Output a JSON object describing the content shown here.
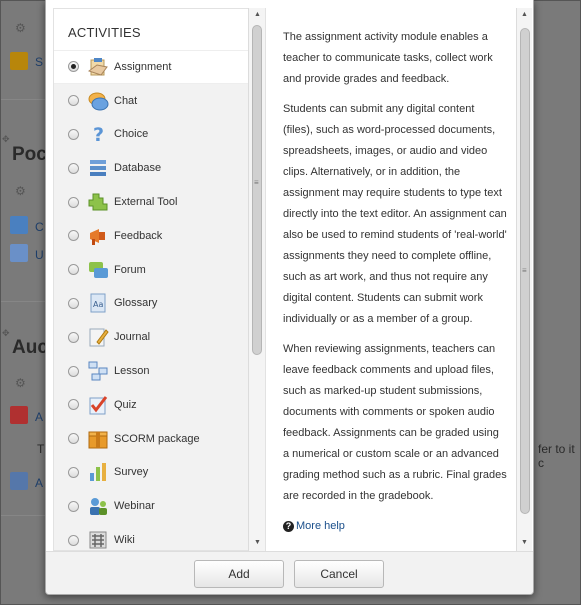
{
  "background": {
    "heading_1": "Poc",
    "heading_2": "Auc",
    "link_1": "S",
    "link_2": "C",
    "link_3": "U",
    "link_4": "A",
    "link_5": "A",
    "text_1": "Tl",
    "text_2": "fer to it c"
  },
  "activities": {
    "heading": "ACTIVITIES",
    "items": [
      {
        "label": "Assignment",
        "icon": "assignment-icon",
        "selected": true
      },
      {
        "label": "Chat",
        "icon": "chat-icon",
        "selected": false
      },
      {
        "label": "Choice",
        "icon": "choice-icon",
        "selected": false
      },
      {
        "label": "Database",
        "icon": "database-icon",
        "selected": false
      },
      {
        "label": "External Tool",
        "icon": "external-tool-icon",
        "selected": false
      },
      {
        "label": "Feedback",
        "icon": "feedback-icon",
        "selected": false
      },
      {
        "label": "Forum",
        "icon": "forum-icon",
        "selected": false
      },
      {
        "label": "Glossary",
        "icon": "glossary-icon",
        "selected": false
      },
      {
        "label": "Journal",
        "icon": "journal-icon",
        "selected": false
      },
      {
        "label": "Lesson",
        "icon": "lesson-icon",
        "selected": false
      },
      {
        "label": "Quiz",
        "icon": "quiz-icon",
        "selected": false
      },
      {
        "label": "SCORM package",
        "icon": "scorm-package-icon",
        "selected": false
      },
      {
        "label": "Survey",
        "icon": "survey-icon",
        "selected": false
      },
      {
        "label": "Webinar",
        "icon": "webinar-icon",
        "selected": false
      },
      {
        "label": "Wiki",
        "icon": "wiki-icon",
        "selected": false
      }
    ]
  },
  "description": {
    "paragraphs": [
      "The assignment activity module enables a teacher to communicate tasks, collect work and provide grades and feedback.",
      "Students can submit any digital content (files), such as word-processed documents, spreadsheets, images, or audio and video clips. Alternatively, or in addition, the assignment may require students to type text directly into the text editor. An assignment can also be used to remind students of 'real-world' assignments they need to complete offline, such as art work, and thus not require any digital content. Students can submit work individually or as a member of a group.",
      "When reviewing assignments, teachers can leave feedback comments and upload files, such as marked-up student submissions, documents with comments or spoken audio feedback. Assignments can be graded using a numerical or custom scale or an advanced grading method such as a rubric. Final grades are recorded in the gradebook."
    ],
    "help_link": "More help",
    "help_icon_glyph": "?"
  },
  "footer": {
    "add_label": "Add",
    "cancel_label": "Cancel"
  },
  "colors": {
    "link": "#1a4f8b",
    "overlay": "#7a7a7a"
  }
}
